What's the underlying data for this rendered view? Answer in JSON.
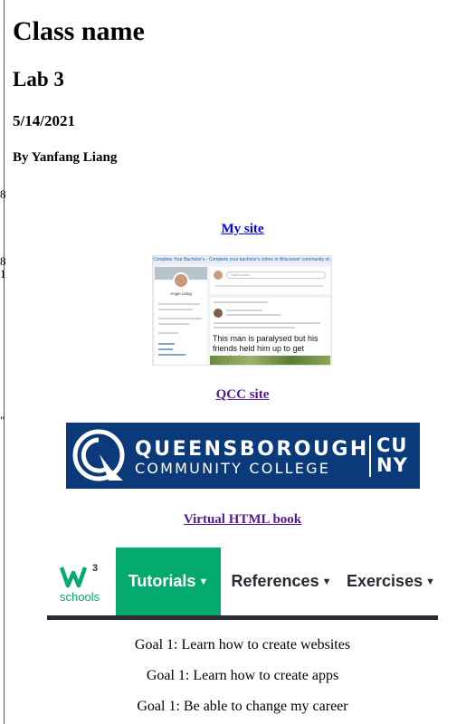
{
  "header": {
    "class_name": "Class name",
    "lab": "Lab 3",
    "date": "5/14/2021",
    "author": "By Yanfang Liang"
  },
  "left_stubs": [
    "8",
    "8",
    "1",
    "\""
  ],
  "links": {
    "my_site": "My site",
    "qcc_site": "QCC site",
    "virtual_book": "Virtual HTML book"
  },
  "my_site_thumbnail": {
    "banner": "Complete Your Bachelor's - Complete your bachelor's online in Wisconsin' community of...",
    "profile_name": "Angie Liang",
    "compose_placeholder": "Start a post",
    "caption": "This man is paralysed but his friends held him up to get married."
  },
  "qcc_banner": {
    "line1": "QUEENSBOROUGH",
    "line2": "COMMUNITY COLLEGE",
    "cuny_top": "CU",
    "cuny_bottom": "NY",
    "bg_color": "#0a3a7a"
  },
  "w3schools": {
    "logo_text": "schools",
    "tabs": [
      "Tutorials",
      "References",
      "Exercises"
    ],
    "accent_color": "#04aa6d"
  },
  "goals": [
    "Goal 1: Learn how to create websites",
    "Goal 1: Learn how to create apps",
    "Goal 1: Be able to change my career"
  ]
}
